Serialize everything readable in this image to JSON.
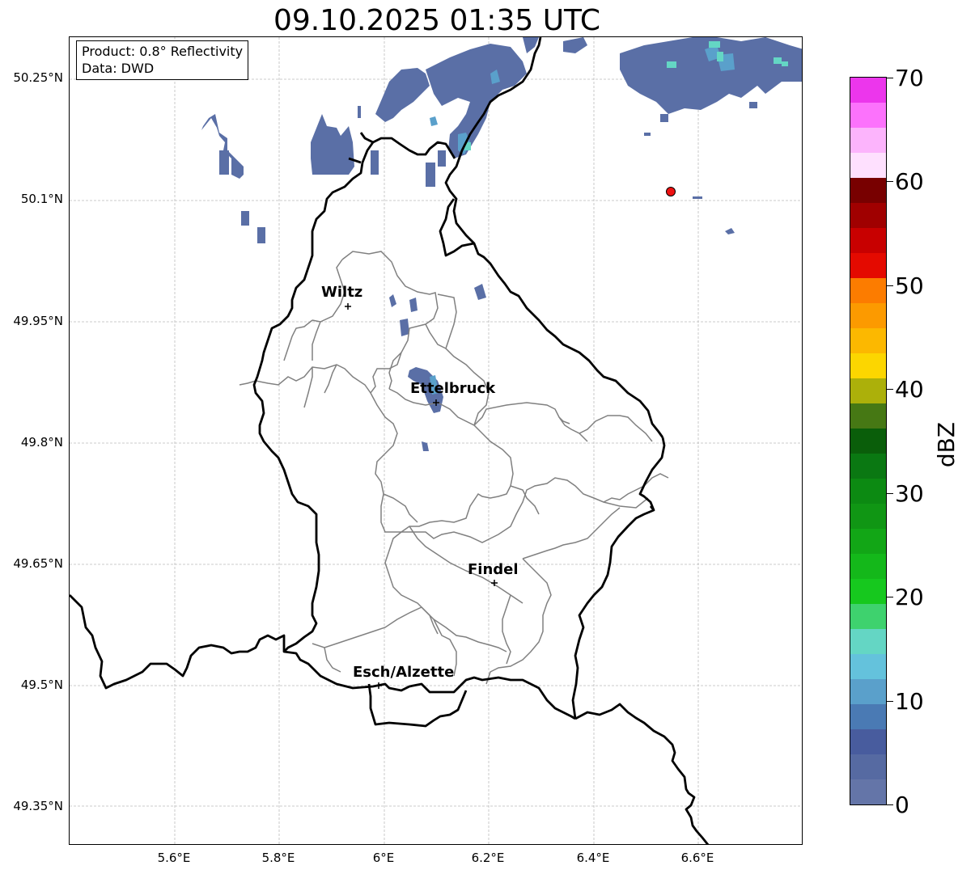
{
  "title": "09.10.2025 01:35 UTC",
  "info_box": {
    "product": "Product: 0.8° Reflectivity",
    "data": "Data: DWD"
  },
  "axes": {
    "lat_labels": [
      "50.25°N",
      "50.1°N",
      "49.95°N",
      "49.8°N",
      "49.65°N",
      "49.5°N",
      "49.35°N"
    ],
    "lon_labels": [
      "5.6°E",
      "5.8°E",
      "6°E",
      "6.2°E",
      "6.4°E",
      "6.6°E"
    ],
    "lat_range": [
      49.3,
      50.3
    ],
    "lon_range": [
      5.4,
      6.8
    ],
    "grid": true
  },
  "cities": [
    {
      "name": "Wiltz",
      "lon": 5.93,
      "lat": 49.967
    },
    {
      "name": "Ettelbruck",
      "lon": 6.1,
      "lat": 49.848
    },
    {
      "name": "Findel",
      "lon": 6.21,
      "lat": 49.627
    },
    {
      "name": "Esch/Alzette",
      "lon": 5.99,
      "lat": 49.498
    }
  ],
  "marker": {
    "lon": 6.545,
    "lat": 50.11,
    "color": "#ee1111"
  },
  "colorbar": {
    "label": "dBZ",
    "min": 0,
    "max": 70,
    "ticks": [
      "0",
      "10",
      "20",
      "30",
      "40",
      "50",
      "60",
      "70"
    ],
    "colors": [
      "#6475a8",
      "#566aa2",
      "#485c9e",
      "#4a7ab4",
      "#5aa0cb",
      "#64c2dc",
      "#64d6c4",
      "#3ed26e",
      "#16c81e",
      "#14b81a",
      "#12a616",
      "#109614",
      "#0c8a12",
      "#0a7812",
      "#0a5e0a",
      "#467814",
      "#acb00a",
      "#fcd600",
      "#fcb800",
      "#fc9a00",
      "#fc7c00",
      "#e40a00",
      "#c80000",
      "#a00000",
      "#780000",
      "#fee0fe",
      "#fcb4fc",
      "#fc72fc",
      "#ec36ec"
    ]
  },
  "legend_colors": {
    "border": "#000000",
    "districts": "#808080",
    "grid": "#bbbbbb"
  }
}
